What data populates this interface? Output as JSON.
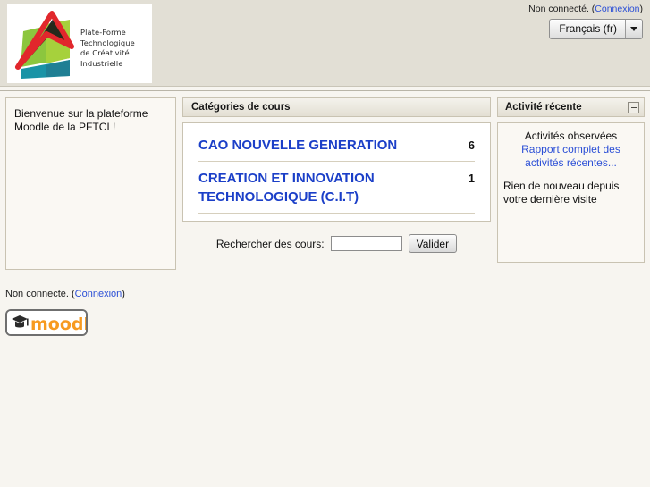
{
  "header": {
    "logo": {
      "icon": "pftci-logo",
      "alt_line_1": "Plate-Forme",
      "alt_line_2": "Technologique",
      "alt_line_3": "de Créativité",
      "alt_line_4": "Industrielle"
    },
    "login_status": "Non connecté. (",
    "login_link": "Connexion",
    "login_status_close": ")",
    "language": {
      "selected": "Français (fr)",
      "options": [
        "Français (fr)"
      ],
      "arrow_icon": "chevron-down-icon"
    }
  },
  "left": {
    "welcome_line_1": "Bienvenue sur la plateforme",
    "welcome_line_2": "Moodle de la PFTCI !"
  },
  "center": {
    "categories_title": "Catégories de cours",
    "categories": [
      {
        "name": "CAO NOUVELLE GENERATION",
        "count": "6"
      },
      {
        "name": "CREATION ET INNOVATION TECHNOLOGIQUE (C.I.T)",
        "count": "1"
      }
    ],
    "search": {
      "label": "Rechercher des cours:",
      "value": "",
      "placeholder": "",
      "button_label": "Valider"
    }
  },
  "right": {
    "activity_title": "Activité récente",
    "collapse_icon": "minus-icon",
    "activity_subtitle": "Activités observées",
    "activity_report_link": "Rapport complet des activités récentes...",
    "nothing_new": "Rien de nouveau depuis votre dernière visite"
  },
  "footer": {
    "login_status": "Non connecté. (",
    "login_link": "Connexion",
    "login_status_close": ")",
    "moodle_logo_text": "moodle"
  },
  "colors": {
    "page_background": "#f7f5f0",
    "header_background": "#e2dfd5",
    "block_background": "#faf8f3",
    "block_border": "#c9c3b2",
    "link_blue": "#2b4fd6",
    "category_blue": "#1b3fc8",
    "moodle_orange": "#f79a1f"
  }
}
